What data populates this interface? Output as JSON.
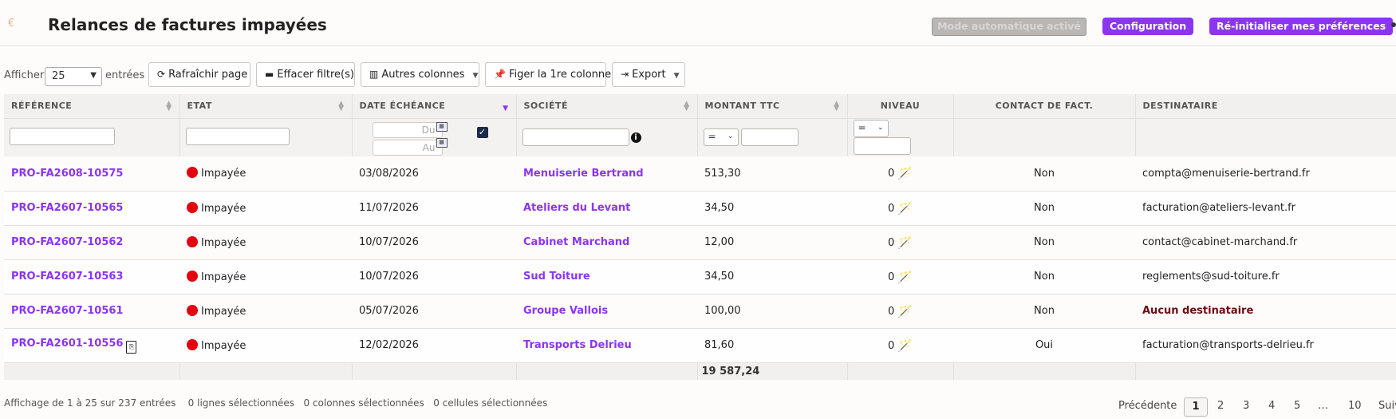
{
  "header": {
    "title": "Relances de factures impayées",
    "auto_mode_label": "Mode automatique activé",
    "config_label": "Configuration",
    "reset_label": "Ré-initialiser mes préférences"
  },
  "toolbar": {
    "show_prefix": "Afficher",
    "page_size": "25",
    "show_suffix": "entrées",
    "refresh_label": "Rafraîchir page",
    "clear_filters_label": "Effacer filtre(s)",
    "columns_label": "Autres colonnes",
    "freeze_label": "Figer la 1re colonne",
    "export_label": "Export"
  },
  "table": {
    "columns": [
      "Référence",
      "Etat",
      "Date échéance",
      "Société",
      "Montant TTC",
      "Niveau",
      "Contact de fact.",
      "Destinataire"
    ],
    "filters": {
      "date_from_placeholder": "Du",
      "date_to_placeholder": "Au",
      "amount_op": "=",
      "level_op": "="
    },
    "rows": [
      {
        "ref": "PRO-FA2608-10575",
        "state": "Impayée",
        "due": "03/08/2026",
        "company": "Menuiserie Bertrand",
        "amount": "513,30",
        "level": "0",
        "contact": "Non",
        "recipient": "compta@menuiserie-bertrand.fr"
      },
      {
        "ref": "PRO-FA2607-10565",
        "state": "Impayée",
        "due": "11/07/2026",
        "company": "Ateliers du Levant",
        "amount": "34,50",
        "level": "0",
        "contact": "Non",
        "recipient": "facturation@ateliers-levant.fr"
      },
      {
        "ref": "PRO-FA2607-10562",
        "state": "Impayée",
        "due": "10/07/2026",
        "company": "Cabinet Marchand",
        "amount": "12,00",
        "level": "0",
        "contact": "Non",
        "recipient": "contact@cabinet-marchand.fr"
      },
      {
        "ref": "PRO-FA2607-10563",
        "state": "Impayée",
        "due": "10/07/2026",
        "company": "Sud Toiture",
        "amount": "34,50",
        "level": "0",
        "contact": "Non",
        "recipient": "reglements@sud-toiture.fr"
      },
      {
        "ref": "PRO-FA2607-10561",
        "state": "Impayée",
        "due": "05/07/2026",
        "company": "Groupe Vallois",
        "amount": "100,00",
        "level": "0",
        "contact": "Non",
        "recipient": "Aucun destinataire"
      },
      {
        "ref": "PRO-FA2601-10556",
        "state": "Impayée",
        "due": "12/02/2026",
        "company": "Transports Delrieu",
        "amount": "81,60",
        "level": "0",
        "contact": "Oui",
        "recipient": "facturation@transports-delrieu.fr"
      }
    ],
    "total_amount": "19 587,24"
  },
  "footer": {
    "info": "Affichage de 1 à 25 sur 237 entrées",
    "rows_selected": "0 lignes sélectionnées",
    "cols_selected": "0 colonnes sélectionnées",
    "cells_selected": "0 cellules sélectionnées",
    "prev_label": "Précédente",
    "pages": [
      "1",
      "2",
      "3",
      "4",
      "5",
      "…",
      "10"
    ],
    "next_label": "Suiv"
  },
  "icons": {
    "app": "euro-icon",
    "state": "red-dot-icon",
    "level": "magic-wand-icon",
    "doc": "pdf-file-icon"
  }
}
